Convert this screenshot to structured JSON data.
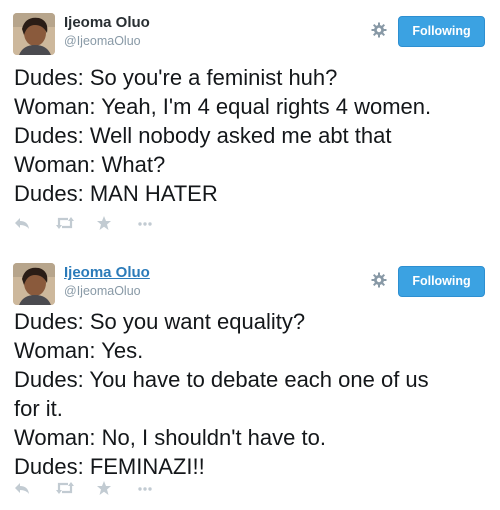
{
  "colors": {
    "follow_button": "#3ba2e2",
    "link_name": "#2b7bb9",
    "muted": "#8899a6",
    "text": "#14171a",
    "action_icons": "#c2cbd2"
  },
  "tweets": [
    {
      "author": {
        "name": "Ijeoma Oluo",
        "handle": "@IjeomaOluo"
      },
      "follow_label": "Following",
      "lines": [
        "Dudes: So you're a feminist huh?",
        "Woman: Yeah, I'm 4 equal rights 4 women.",
        "Dudes: Well nobody asked me abt that",
        "Woman: What?",
        "Dudes: MAN HATER"
      ],
      "icons": [
        "avatar",
        "gear-icon",
        "reply-icon",
        "retweet-icon",
        "favorite-star-icon",
        "more-dots-icon"
      ]
    },
    {
      "author": {
        "name": "Ijeoma Oluo",
        "handle": "@IjeomaOluo"
      },
      "follow_label": "Following",
      "lines": [
        "Dudes: So you want equality?",
        "Woman: Yes.",
        "Dudes: You have to debate each one of us",
        "for it.",
        "Woman: No, I shouldn't have to.",
        "Dudes: FEMINAZI!!"
      ],
      "icons": [
        "avatar",
        "gear-icon",
        "reply-icon",
        "retweet-icon",
        "favorite-star-icon",
        "more-dots-icon"
      ]
    }
  ]
}
